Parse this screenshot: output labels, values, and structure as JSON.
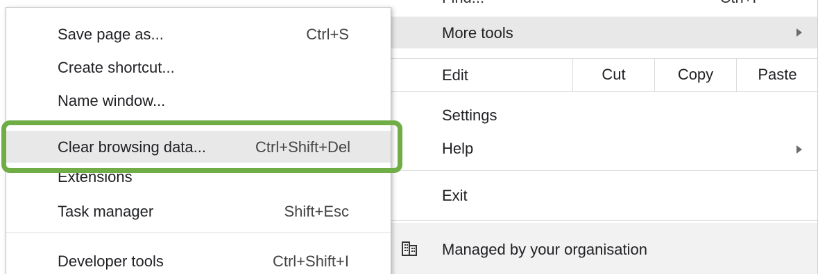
{
  "main_menu": {
    "truncated_top": {
      "left": "Find...",
      "right": "Ctrl+F"
    },
    "more_tools": {
      "label": "More tools"
    },
    "edit": {
      "label": "Edit",
      "cut": "Cut",
      "copy": "Copy",
      "paste": "Paste"
    },
    "settings": {
      "label": "Settings"
    },
    "help": {
      "label": "Help"
    },
    "exit": {
      "label": "Exit"
    },
    "managed": {
      "label": "Managed by your organisation",
      "icon": "building-icon"
    }
  },
  "submenu": {
    "items": [
      {
        "label": "Save page as...",
        "shortcut": "Ctrl+S"
      },
      {
        "label": "Create shortcut...",
        "shortcut": ""
      },
      {
        "label": "Name window...",
        "shortcut": ""
      },
      {
        "label": "Clear browsing data...",
        "shortcut": "Ctrl+Shift+Del"
      },
      {
        "label": "Extensions",
        "shortcut": ""
      },
      {
        "label": "Task manager",
        "shortcut": "Shift+Esc"
      },
      {
        "label": "Developer tools",
        "shortcut": "Ctrl+Shift+I"
      }
    ]
  },
  "colors": {
    "highlight_border": "#70ad47",
    "hover_background": "#e8e8e8"
  }
}
